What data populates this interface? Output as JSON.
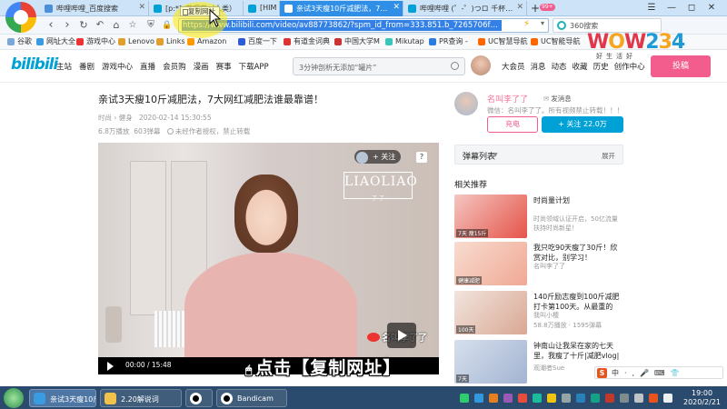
{
  "browser": {
    "tabs": [
      {
        "label": "哔哩哔哩_百度搜索",
        "active": false
      },
      {
        "label": "[p:*]_哔哩哔（人类）",
        "active": false
      },
      {
        "label": "[HIM",
        "active": false
      },
      {
        "label": "亲试3天瘦10斤减肥法，7大网",
        "active": true
      },
      {
        "label": "哔哩哔哩 (゜-゜)つロ 千杯~-bi",
        "active": false
      }
    ],
    "new_tab": "+",
    "window_controls": [
      "☰",
      "—",
      "◻",
      "✕"
    ],
    "url": "https://www.bilibili.com/video/av88773862/?spm_id_from=333.851.b_7265706f727446697",
    "search_placeholder": "360搜索",
    "copy_tooltip": "复制网址",
    "bookmarks": [
      "谷歌",
      "网址大全",
      "游戏中心",
      "Lenovo",
      "Links",
      "Amazon",
      "百度一下",
      "有道金词典",
      "中国大学M",
      "Mikutap",
      "PR查询 -",
      "UC智慧导航",
      "UC智能导航"
    ]
  },
  "bilibili": {
    "logo": "bilibili",
    "nav": [
      "主站",
      "番剧",
      "游戏中心",
      "直播",
      "会员购",
      "漫画",
      "赛事",
      "下载APP"
    ],
    "search_placeholder": "3分钟剖析无添加“罐片”",
    "user_nav": [
      "大会员",
      "消息",
      "动态",
      "收藏",
      "历史",
      "创作中心"
    ],
    "message_badge": "99+",
    "upload": "投稿"
  },
  "watermark": {
    "text": "WOW234",
    "sub": "好生活好"
  },
  "video": {
    "title": "亲试3天瘦10斤减肥法，7大网红减肥法谁最靠谱！",
    "category": "时尚 › 健身",
    "date": "2020-02-14 15:30:55",
    "views": "6.8万播放",
    "danmaku_count": "603弹幕",
    "notice": "未经作者授权，禁止转载",
    "brand_text": "LIAOLIAO",
    "brand_sub": "了  了",
    "follow_pill": "+ 关注",
    "help": "?",
    "weibo": "名叫李了了",
    "time": "00:00 / 15:48"
  },
  "uploader": {
    "name": "名叫李了了",
    "message": "发消息",
    "desc": "微信：名叫李了了。所有视频禁止转载！！！",
    "charge": "充电",
    "follow": "+ 关注 22.0万"
  },
  "danmaku": {
    "label": "弹幕列表",
    "caret": "▼",
    "expand": "展开"
  },
  "recommend": {
    "title": "相关推荐",
    "items": [
      {
        "title": "时尚量计划",
        "up": "",
        "stats": "时尚领域认证开启，50亿流量扶持时尚新星！",
        "thumb_label": "7天 瘦15斤",
        "colors": [
          "#f2c2c2",
          "#e74c3c"
        ]
      },
      {
        "title": "我只吃90天瘦了30斤！欣赏对比，别学习！",
        "up": "名叫李了了",
        "stats": "",
        "thumb_label": "健康减肥",
        "colors": [
          "#f5d8c9",
          "#f2b7a4"
        ]
      },
      {
        "title": "140斤励志瘦到100斤减肥打卡第100天。从最重的",
        "up": "我叫小樱",
        "stats": "58.8万播放 · 1595弹幕",
        "thumb_label": "100天",
        "colors": [
          "#f3e1dc",
          "#e0b5a5"
        ]
      },
      {
        "title": "钟南山让我呆在家的七天里，我瘦了十斤|减肥vlog|",
        "up": "观潮者Sue",
        "stats": "",
        "thumb_label": "7天",
        "colors": [
          "#cfd8e8",
          "#a9b9d6"
        ]
      }
    ]
  },
  "caption": {
    "mouse": "🖱",
    "text": "点击【复制网址】"
  },
  "ime": {
    "logo": "S",
    "items": "中·,🎤⌨👕"
  },
  "taskbar": {
    "tasks": [
      {
        "label": "亲试3天瘦10斤减",
        "active": true,
        "color": "#3a9be0"
      },
      {
        "label": "2.20解说词",
        "active": false,
        "color": "#f0c24c"
      },
      {
        "label": "",
        "active": false,
        "color": "#c0392b"
      },
      {
        "label": "Bandicam",
        "active": false,
        "color": "#c0392b"
      }
    ],
    "time": "19:00",
    "date": "2020/2/21"
  },
  "colors": {
    "bili_blue": "#00a1d6",
    "bili_pink": "#f25d8e",
    "tab_active": "#2f8fe6",
    "taskbar": "#2b4b6e"
  }
}
